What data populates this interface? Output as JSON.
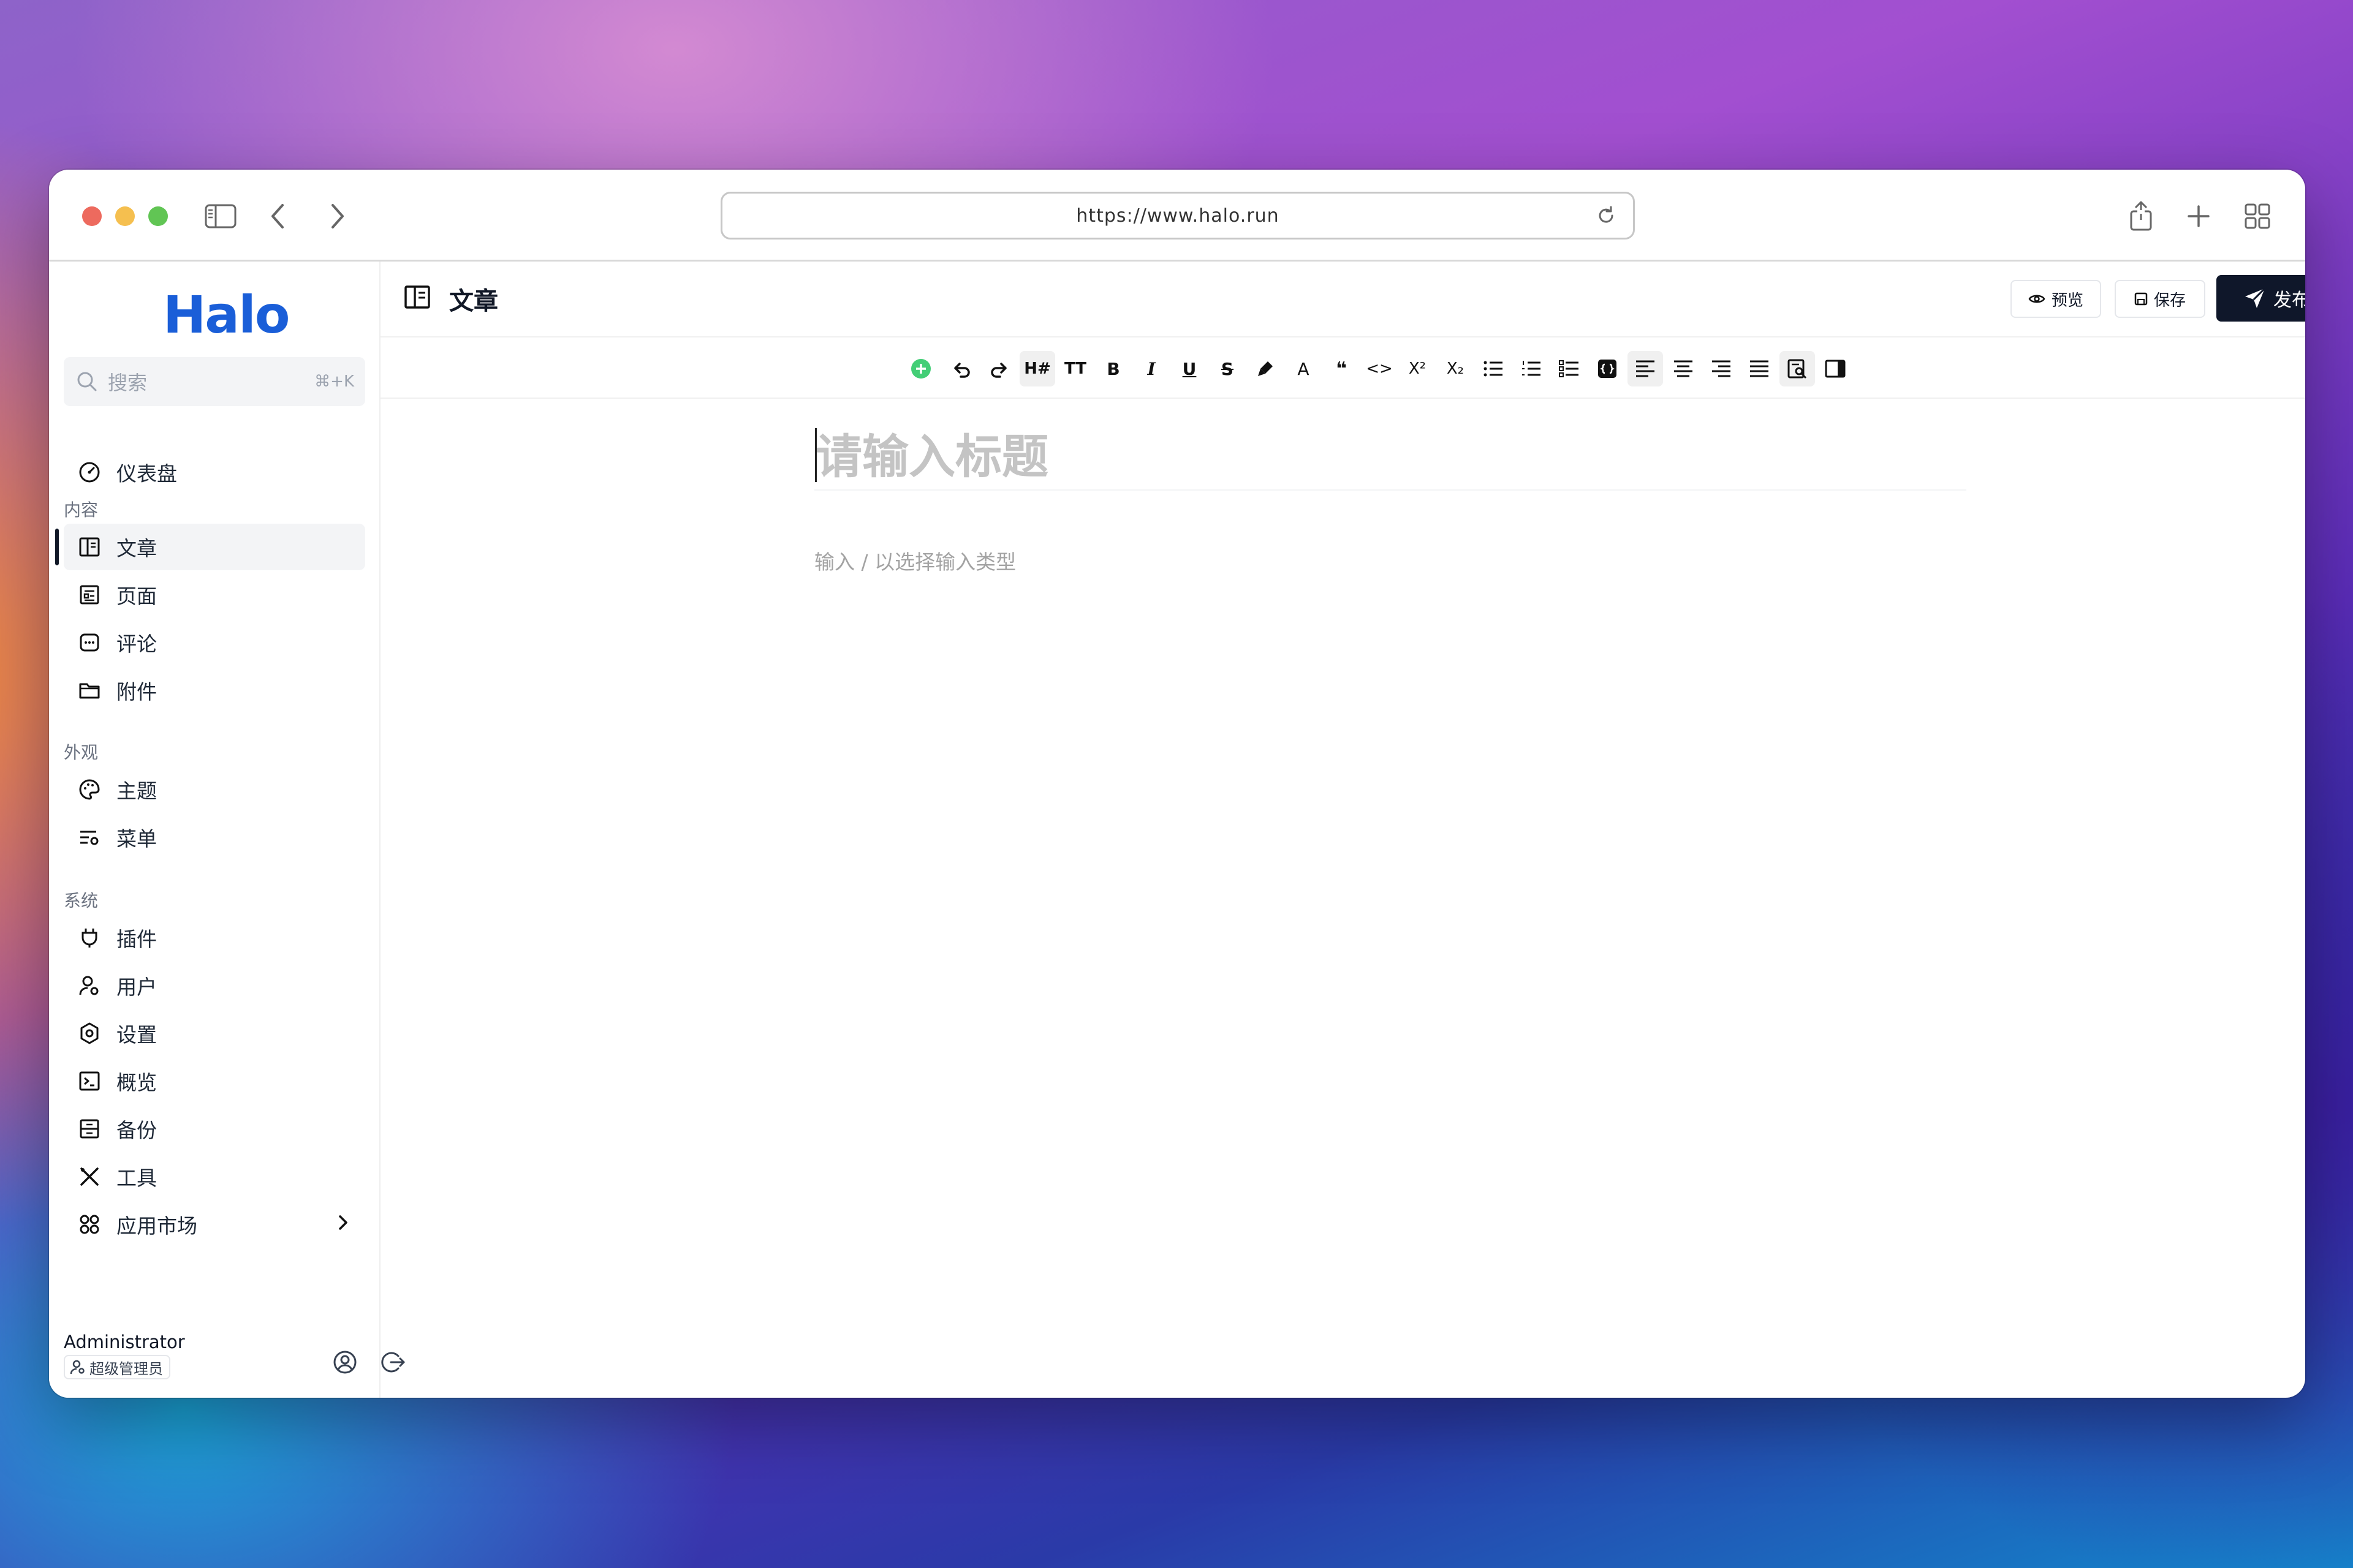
{
  "browser": {
    "url": "https://www.halo.run"
  },
  "sidebar": {
    "logo": "Halo",
    "search": {
      "placeholder": "搜索",
      "shortcut": "⌘+K"
    },
    "dashboard": "仪表盘",
    "groups": {
      "content": "内容",
      "appearance": "外观",
      "system": "系统"
    },
    "items": {
      "posts": "文章",
      "pages": "页面",
      "comments": "评论",
      "attachments": "附件",
      "themes": "主题",
      "menus": "菜单",
      "plugins": "插件",
      "users": "用户",
      "settings": "设置",
      "overview": "概览",
      "backup": "备份",
      "tools": "工具",
      "market": "应用市场"
    },
    "user": {
      "name": "Administrator",
      "role": "超级管理员"
    }
  },
  "header": {
    "title": "文章",
    "preview_label": "预览",
    "save_label": "保存",
    "publish_label": "发布"
  },
  "toolbar": {
    "heading": "H#",
    "text_size": "TT",
    "bold": "B",
    "italic": "I",
    "underline": "U",
    "strike": "S",
    "color_text": "A",
    "quote": "❝",
    "code": "<>",
    "superscript": "X²",
    "subscript": "X₂"
  },
  "editor": {
    "title_placeholder": "请输入标题",
    "body_placeholder": "输入 / 以选择输入类型"
  },
  "colors": {
    "accent": "#1a5ed8",
    "primary_button": "#0f172a",
    "add_block": "#22c55e"
  }
}
